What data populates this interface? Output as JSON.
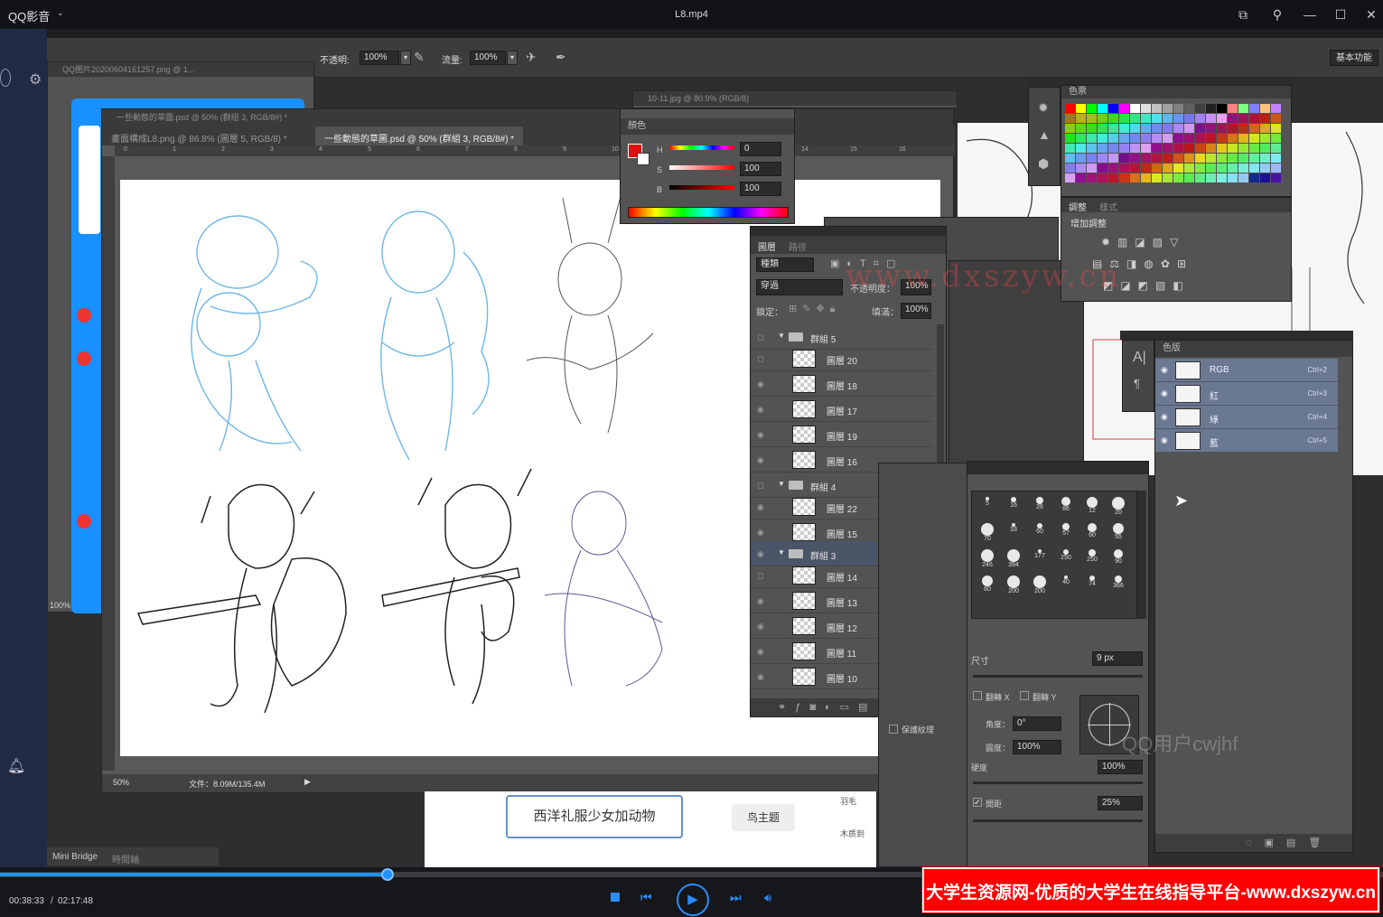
{
  "player": {
    "app_name": "QQ影音",
    "file_title": "L8.mp4",
    "time_current": "00:38:33",
    "time_total": "02:17:48",
    "progress": 0.28,
    "watermark_corner": "大学生资源网-优质的大学生在线指导平台-www.dxszyw.cn",
    "watermark_url": "www.dxszyw.cn",
    "watermark_user": "QQ用户cwjhf"
  },
  "ps": {
    "options": {
      "opacity_label": "不透明:",
      "opacity_value": "100%",
      "flow_label": "流量:",
      "flow_value": "100%",
      "workspace": "基本功能"
    },
    "windows": {
      "qq_image_title": "QQ图片20200604161257.png @ 1...",
      "jpg_title": "10-11.jpg @ 80.9% (RGB/8)",
      "main_title": "一些動態的草圖.psd @ 50% (群组 3, RGB/8#) *",
      "tab1": "畫面構成L8.png @ 86.8% (圖層 5, RGB/8) *",
      "tab2": "一些動態的草圖.psd @ 50% (群組 3, RGB/8#) *",
      "zoom": "50%",
      "file_info": "文件：8.09M/135.4M",
      "qq_zoom": "100%",
      "ruler": [
        "0",
        "1",
        "2",
        "3",
        "4",
        "5",
        "6",
        "7",
        "8",
        "9",
        "10",
        "14",
        "15",
        "16"
      ]
    },
    "color_panel": {
      "title": "顏色",
      "h_label": "H",
      "h_value": "0",
      "s_label": "S",
      "s_value": "100",
      "b_label": "B",
      "b_value": "100",
      "fg_color": "#e01010"
    },
    "layers_panel": {
      "tab_layers": "圖層",
      "tab_paths": "路徑",
      "kind": "種類",
      "blend": "穿過",
      "opacity_label": "不透明度：",
      "opacity_value": "100%",
      "lock_label": "鎖定：",
      "fill_label": "填滿：",
      "fill_value": "100%",
      "rows": [
        {
          "name": "群組 5",
          "group": true
        },
        {
          "name": "圖層 20",
          "group": false
        },
        {
          "name": "圖層 18",
          "group": false
        },
        {
          "name": "圖層 17",
          "group": false
        },
        {
          "name": "圖層 19",
          "group": false
        },
        {
          "name": "圖層 16",
          "group": false
        },
        {
          "name": "群組 4",
          "group": true
        },
        {
          "name": "圖層 22",
          "group": false
        },
        {
          "name": "圖層 15",
          "group": false
        },
        {
          "name": "群組 3",
          "group": true
        },
        {
          "name": "圖層 14",
          "group": false
        },
        {
          "name": "圖層 13",
          "group": false
        },
        {
          "name": "圖層 12",
          "group": false
        },
        {
          "name": "圖層 11",
          "group": false
        },
        {
          "name": "圖層 10",
          "group": false
        }
      ]
    },
    "swatches": {
      "title": "色票",
      "adjust_tab": "調整",
      "style_tab": "樣式",
      "add_adjust": "增加調整"
    },
    "channels": {
      "title": "色版",
      "rows": [
        {
          "name": "RGB",
          "shortcut": "Ctrl+2"
        },
        {
          "name": "紅",
          "shortcut": "Ctrl+3"
        },
        {
          "name": "綠",
          "shortcut": "Ctrl+4"
        },
        {
          "name": "藍",
          "shortcut": "Ctrl+5"
        }
      ]
    },
    "brush_panel": {
      "sizes": [
        "5",
        "16",
        "26",
        "86",
        "12",
        "20",
        "70",
        "33",
        "60",
        "57",
        "60",
        "55",
        "246",
        "394",
        "177",
        "250",
        "250",
        "90",
        "60",
        "200",
        "200",
        "40",
        "74",
        "366"
      ],
      "size_label": "尺寸",
      "size_value": "9 px",
      "flip_x": "翻轉 X",
      "flip_y": "翻轉 Y",
      "angle_label": "角度：",
      "angle_value": "0°",
      "round_label": "圓度：",
      "round_value": "100%",
      "hardness_label": "硬度",
      "hardness_value": "100%",
      "spacing_label": "間距",
      "spacing_value": "25%",
      "protect_texture": "保護紋理"
    },
    "bottom_tabs": {
      "mini_bridge": "Mini Bridge",
      "timeline": "時間軸"
    },
    "mindmap": {
      "node_main": "西洋礼服少女加动物",
      "node_bird": "鸟主题",
      "node_a": "羽毛",
      "node_b": "木质到"
    }
  }
}
